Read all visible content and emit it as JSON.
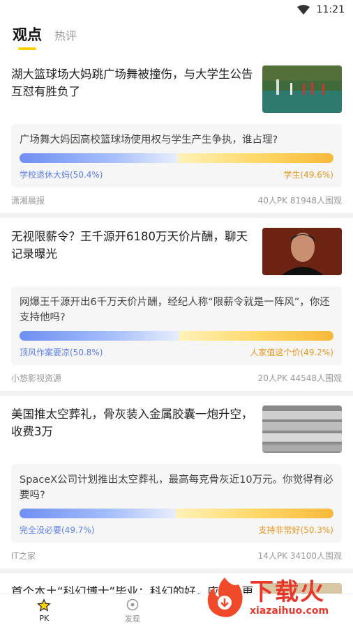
{
  "status_bar": {
    "time": "11:21"
  },
  "tabs": [
    {
      "label": "观点",
      "active": true
    },
    {
      "label": "热评",
      "active": false
    }
  ],
  "cards": [
    {
      "title": "湖大篮球场大妈跳广场舞被撞伤，与大学生公告互怼有胜负了",
      "question": "广场舞大妈因高校篮球场使用权与学生产生争执，谁占理?",
      "left_option": "学校退休大妈(50.4%)",
      "right_option": "学生(49.6%)",
      "left_share": 0.504,
      "source": "潇湘晨报",
      "stats": "40人PK  81948人围观",
      "thumb": "basketball-court-photo"
    },
    {
      "title": "无视限薪令？王千源开6180万天价片酬，聊天记录曝光",
      "question": "网爆王千源开出6千万天价片酬，经纪人称“限薪令就是一阵风”，你还支持他吗?",
      "left_option": "顶风作案要凉(50.8%)",
      "right_option": "人家值这个价(49.2%)",
      "left_share": 0.508,
      "source": "小悠影视资源",
      "stats": "20人PK  44548人围观",
      "thumb": "actor-portrait-photo"
    },
    {
      "title": "美国推太空葬礼，骨灰装入金属胶囊一炮升空，收费3万",
      "question": "SpaceX公司计划推出太空葬礼，最高每克骨灰近10万元。你觉得有必要吗?",
      "left_option": "完全没必要(49.7%)",
      "right_option": "支持非常好(50.3%)",
      "left_share": 0.497,
      "source": "IT之家",
      "stats": "14人PK  34100人围观",
      "thumb": "metal-capsules-photo"
    },
    {
      "title": "首个本土“科幻博士”毕业：科幻的好，应该让更多人知道",
      "thumb": "graduate-photo"
    }
  ],
  "bottom_nav": [
    {
      "label": "PK",
      "icon": "star-icon",
      "active": true
    },
    {
      "label": "发现",
      "icon": "compass-icon",
      "active": false
    }
  ],
  "watermark": {
    "big": "下载火",
    "small": "xiazaihuo.com"
  },
  "colors": {
    "accent": "#ffd200",
    "left_blue": "#5b7ef0",
    "right_orange": "#e8961e",
    "brand_red": "#e8372a"
  }
}
